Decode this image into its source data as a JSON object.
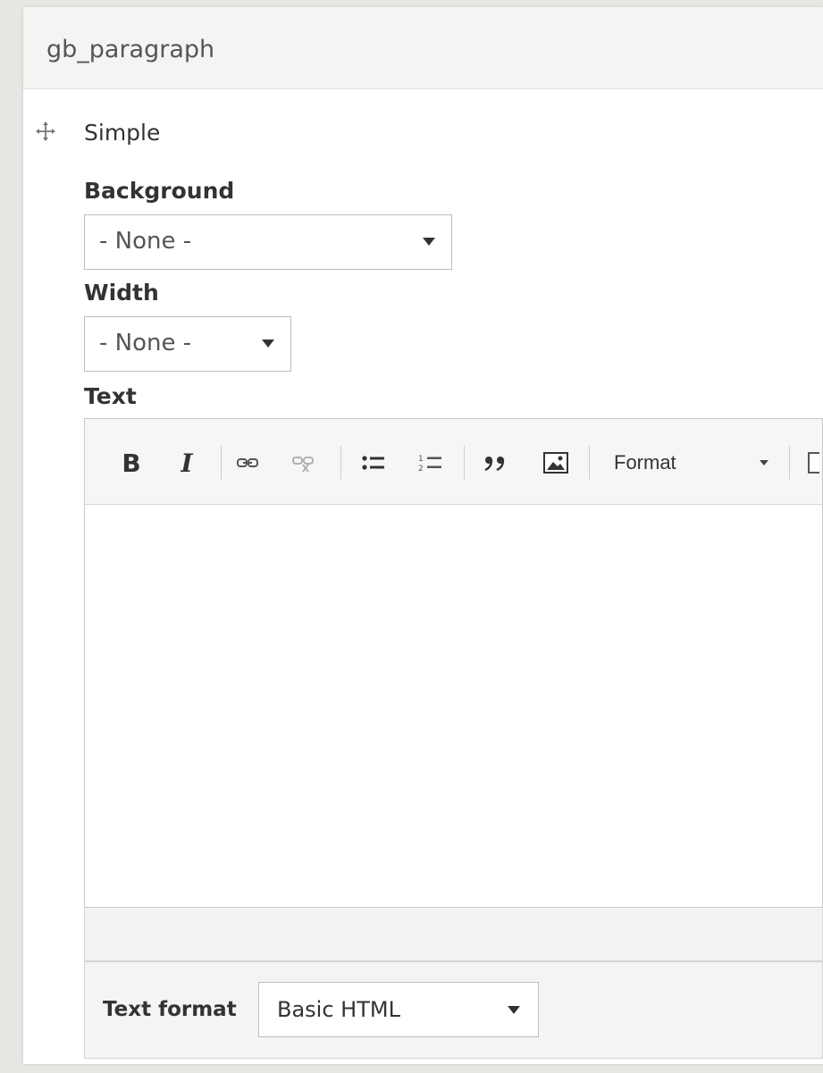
{
  "panel": {
    "title": "gb_paragraph"
  },
  "item": {
    "name": "Simple"
  },
  "fields": {
    "background": {
      "label": "Background",
      "value": "- None -"
    },
    "width": {
      "label": "Width",
      "value": "- None -"
    },
    "text": {
      "label": "Text"
    }
  },
  "toolbar": {
    "bold_label": "B",
    "italic_label": "I",
    "format_label": "Format",
    "icons": [
      "link-icon",
      "unlink-icon",
      "bulleted-list-icon",
      "numbered-list-icon",
      "blockquote-icon",
      "image-icon"
    ]
  },
  "text_format": {
    "label": "Text format",
    "value": "Basic HTML"
  }
}
